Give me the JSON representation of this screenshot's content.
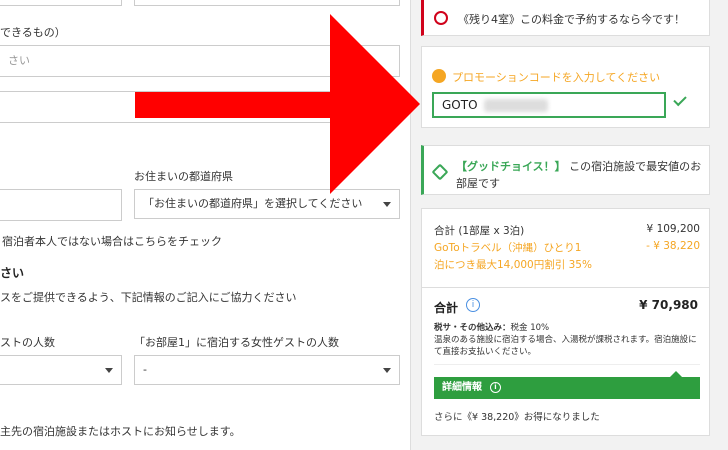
{
  "form": {
    "top_partial_label": "できるもの）",
    "top_placeholder": "さい",
    "prefecture_label": "お住まいの都道府県",
    "prefecture_select": "「お住まいの都道府県」を選択してください",
    "non_guest_check": "宿泊者本人ではない場合はこちらをチェック",
    "section_title": "さい",
    "section_desc": "スをご提供できるよう、下記情報のご記入にご協力ください",
    "male_guest_label": "ストの人数",
    "female_guest_label": "「お部屋1」に宿泊する女性ゲストの人数",
    "female_guest_value": "-",
    "footer_note": "主先の宿泊施設またはホストにお知らせします。"
  },
  "warning": {
    "text": "《残り4室》この料金で予約するなら今です！"
  },
  "promo": {
    "label": "プロモーションコードを入力してください",
    "code_value": "GOTO"
  },
  "good_choice": {
    "highlight": "【グッドチョイス！】",
    "text": "この宿泊施設で最安値のお部屋です"
  },
  "price": {
    "subtotal_label": "合計 (1部屋 x 3泊)",
    "subtotal_value": "¥ 109,200",
    "discount_line1": "GoToトラベル（沖縄）ひとり1",
    "discount_value": "- ¥ 38,220",
    "discount_line2": "泊につき最大14,000円割引 35%",
    "total_label": "合計",
    "total_value": "¥ 70,980",
    "tax_title": "税サ・その他込み：",
    "tax_text": "税金 10%",
    "tax_note": "温泉のある施設に宿泊する場合、入湯税が課税されます。宿泊施設にて直接お支払いください。",
    "detail_label": "詳細情報",
    "savings_text": "さらに《¥ 38,220》お得になりました"
  },
  "colors": {
    "accent_green": "#2e9e3f",
    "promo_orange": "#f5a623",
    "warning_red": "#d0021b",
    "arrow_red": "#ff0000"
  }
}
